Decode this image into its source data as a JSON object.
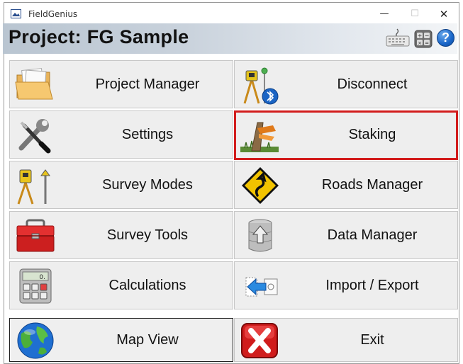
{
  "window": {
    "title": "FieldGenius",
    "minimize": "—",
    "maximize": "☐",
    "close": "✕"
  },
  "header": {
    "project_title": "Project: FG Sample",
    "keyboard_icon": "keyboard-icon",
    "calculator_icon": "calculator-icon",
    "help_icon": "help-icon",
    "help_symbol": "?"
  },
  "menu": {
    "project_manager": "Project Manager",
    "disconnect": "Disconnect",
    "settings": "Settings",
    "staking": "Staking",
    "survey_modes": "Survey Modes",
    "roads_manager": "Roads Manager",
    "survey_tools": "Survey Tools",
    "data_manager": "Data Manager",
    "calculations": "Calculations",
    "import_export": "Import / Export",
    "map_view": "Map View",
    "exit": "Exit"
  },
  "colors": {
    "highlight": "#d21c1c",
    "tile_bg": "#eeeeee",
    "help_blue": "#1a66c8"
  }
}
